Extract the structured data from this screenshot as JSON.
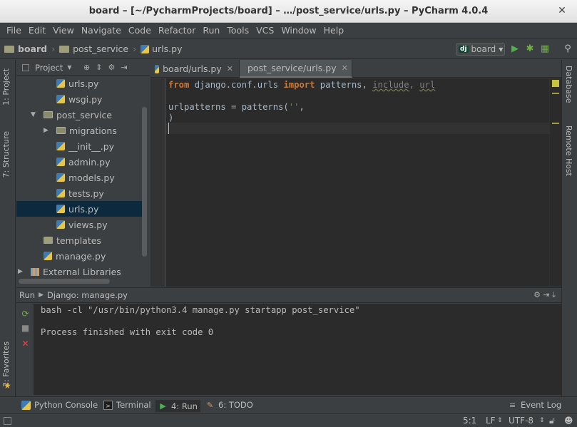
{
  "window": {
    "title": "board – [~/PycharmProjects/board] – …/post_service/urls.py – PyCharm 4.0.4"
  },
  "menu": [
    "File",
    "Edit",
    "View",
    "Navigate",
    "Code",
    "Refactor",
    "Run",
    "Tools",
    "VCS",
    "Window",
    "Help"
  ],
  "navbar": {
    "crumbs": [
      "board",
      "post_service",
      "urls.py"
    ],
    "run_config": "board"
  },
  "left_stripe": {
    "project_tab": "1: Project",
    "structure_tab": "7: Structure",
    "favorites_tab": "2: Favorites"
  },
  "right_stripe": {
    "database_tab": "Database",
    "remote_tab": "Remote Host"
  },
  "project_panel": {
    "view_label": "Project",
    "tree": [
      {
        "label": "urls.py",
        "type": "file",
        "depth": 2
      },
      {
        "label": "wsgi.py",
        "type": "file",
        "depth": 2
      },
      {
        "label": "post_service",
        "type": "package",
        "depth": 1,
        "expanded": true
      },
      {
        "label": "migrations",
        "type": "package",
        "depth": 2,
        "expanded": false
      },
      {
        "label": "__init__.py",
        "type": "file",
        "depth": 2
      },
      {
        "label": "admin.py",
        "type": "file",
        "depth": 2
      },
      {
        "label": "models.py",
        "type": "file",
        "depth": 2
      },
      {
        "label": "tests.py",
        "type": "file",
        "depth": 2
      },
      {
        "label": "urls.py",
        "type": "file",
        "depth": 2,
        "selected": true
      },
      {
        "label": "views.py",
        "type": "file",
        "depth": 2
      },
      {
        "label": "templates",
        "type": "folder",
        "depth": 1
      },
      {
        "label": "manage.py",
        "type": "file",
        "depth": 1
      },
      {
        "label": "External Libraries",
        "type": "library",
        "depth": 0,
        "expanded": false
      }
    ]
  },
  "editor": {
    "tabs": [
      {
        "label": "board/urls.py",
        "active": false
      },
      {
        "label": "post_service/urls.py",
        "active": true
      }
    ],
    "code": {
      "line1": {
        "kw1": "from",
        "mod": " django.conf.urls ",
        "kw2": "import",
        "names": " patterns, ",
        "u1": "include",
        "comma": ", ",
        "u2": "url"
      },
      "line3": {
        "text": "urlpatterns = patterns(",
        "str": "''",
        "tail": ","
      },
      "line4": ")"
    }
  },
  "run_panel": {
    "label": "Run",
    "config": "Django: manage.py",
    "output": [
      "bash -cl \"/usr/bin/python3.4 manage.py startapp post_service\"",
      "",
      "Process finished with exit code 0"
    ]
  },
  "bottom_tools": {
    "python_console": "Python Console",
    "terminal": "Terminal",
    "run": "4: Run",
    "todo": "6: TODO",
    "event_log": "Event Log"
  },
  "status": {
    "position": "5:1",
    "line_sep": "LF",
    "encoding": "UTF-8"
  }
}
